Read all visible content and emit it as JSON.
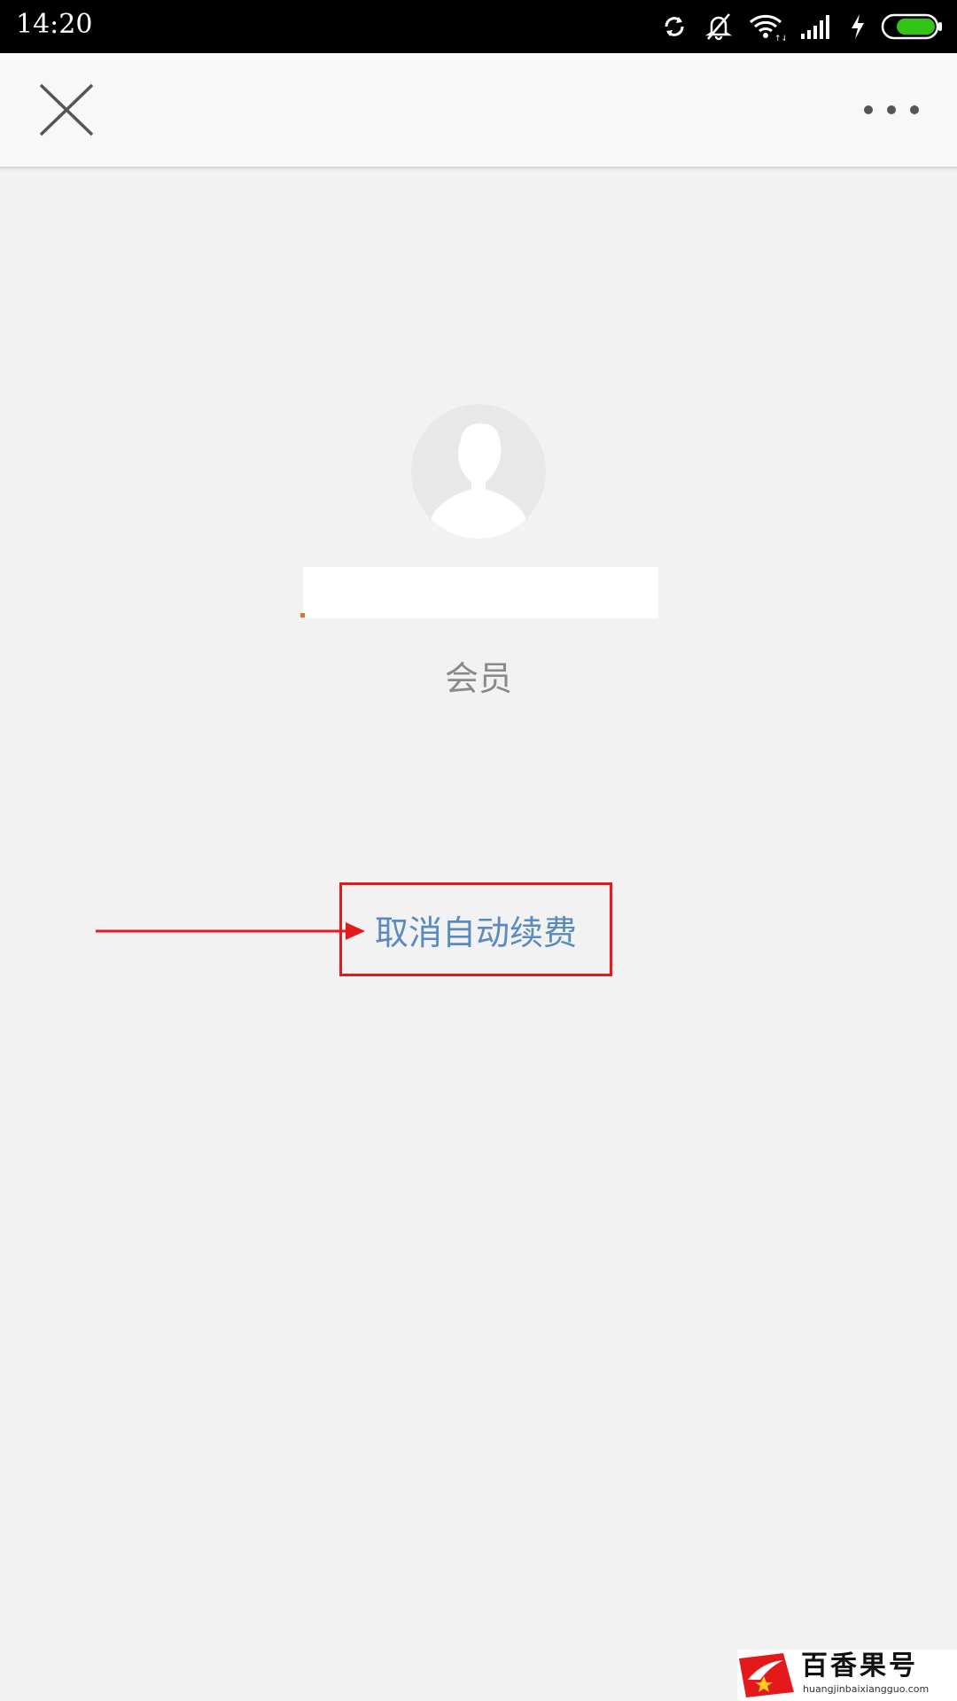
{
  "status_bar": {
    "time": "14:20",
    "icons": [
      "sync-icon",
      "bell-off-icon",
      "wifi-icon",
      "signal-icon",
      "charging-icon",
      "battery-icon"
    ],
    "battery_color": "#33c418"
  },
  "title_bar": {
    "close_icon": "close-icon",
    "more_icon": "more-horizontal-icon"
  },
  "profile": {
    "membership_label": "会员"
  },
  "actions": {
    "cancel_auto_renew_label": "取消自动续费",
    "link_color": "#5a8bbf"
  },
  "annotation": {
    "color": "#e3191c"
  },
  "watermark": {
    "title": "百香果号",
    "subtitle": "huangjinbaixiangguo.com",
    "brand_color": "#e3191c"
  }
}
